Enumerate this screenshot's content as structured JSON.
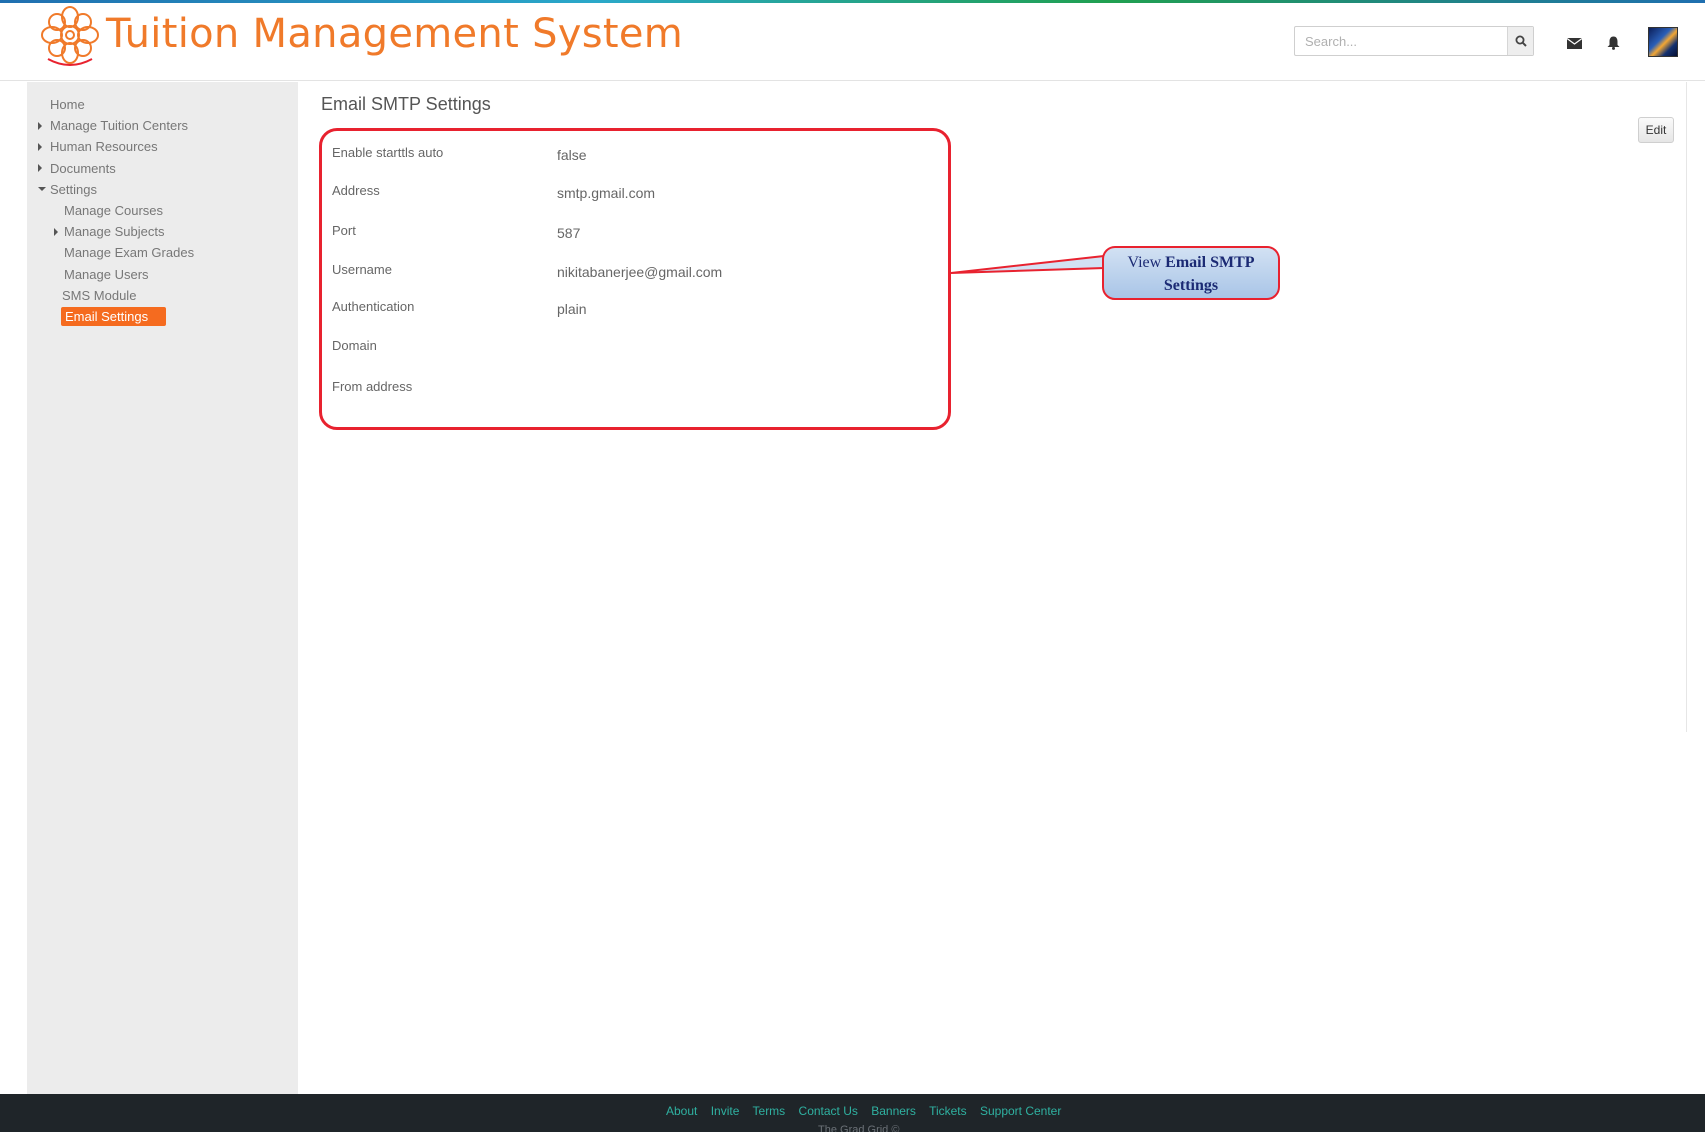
{
  "header": {
    "title": "Tuition Management System",
    "search_placeholder": "Search..."
  },
  "sidebar": {
    "items": [
      {
        "label": "Home"
      },
      {
        "label": "Manage Tuition Centers"
      },
      {
        "label": "Human Resources"
      },
      {
        "label": "Documents"
      },
      {
        "label": "Settings"
      },
      {
        "label": "Manage Courses"
      },
      {
        "label": "Manage Subjects"
      },
      {
        "label": "Manage Exam Grades"
      },
      {
        "label": "Manage Users"
      },
      {
        "label": "SMS Module"
      },
      {
        "label": "Email Settings"
      }
    ]
  },
  "main": {
    "title": "Email SMTP Settings",
    "edit_label": "Edit",
    "fields": [
      {
        "label": "Enable starttls auto",
        "value": "false"
      },
      {
        "label": "Address",
        "value": "smtp.gmail.com"
      },
      {
        "label": "Port",
        "value": "587"
      },
      {
        "label": "Username",
        "value": "nikitabanerjee@gmail.com"
      },
      {
        "label": "Authentication",
        "value": "plain"
      },
      {
        "label": "Domain",
        "value": ""
      },
      {
        "label": "From address",
        "value": ""
      }
    ]
  },
  "callout": {
    "prefix": "View",
    "bold_line1": "Email SMTP",
    "bold_line2": "Settings"
  },
  "footer": {
    "links": [
      "About",
      "Invite",
      "Terms",
      "Contact Us",
      "Banners",
      "Tickets",
      "Support Center"
    ],
    "copyright": "The Grad Grid ©"
  },
  "colors": {
    "brand_orange": "#f07a2a",
    "active_item": "#f56b1f",
    "highlight_red": "#e8222f",
    "footer_bg": "#1f2529",
    "footer_link": "#2fb1a1"
  },
  "icons": [
    "logo-icon",
    "search-icon",
    "mail-icon",
    "bell-icon",
    "avatar"
  ]
}
